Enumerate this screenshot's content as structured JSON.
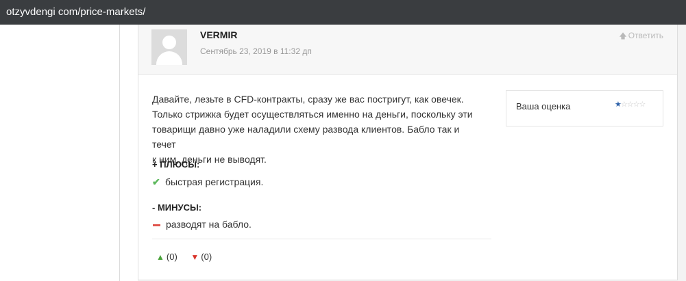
{
  "browser": {
    "url": "otzyvdengi com/price-markets/"
  },
  "comment": {
    "author": "VERMIR",
    "date": "Сентябрь 23, 2019 в 11:32 дп",
    "reply_label": "Ответить",
    "body_lines": [
      "Давайте, лезьте в CFD-контракты, сразу же вас постригут, как овечек.",
      "Только стрижка будет осуществляться именно на деньги, поскольку эти",
      "товарищи давно уже наладили схему развода клиентов. Бабло так и течет",
      "к ним, деньги не выводят."
    ],
    "pros_title": "+ ПЛЮСЫ:",
    "pros": [
      "быстрая регистрация."
    ],
    "cons_title": "- МИНУСЫ:",
    "cons": [
      "разводят на бабло."
    ],
    "likes": "(0)",
    "dislikes": "(0)",
    "rating": {
      "label": "Ваша оценка",
      "value": 1,
      "max": 5
    }
  },
  "colors": {
    "urlbar_bg": "#3a3d40",
    "pros_icon": "#5cb85c",
    "cons_icon": "#e0544c",
    "like_icon": "#4aa33b",
    "dislike_icon": "#d9342b",
    "star_filled": "#2a5fa8"
  },
  "icons": {
    "reply": "arrow-up-icon",
    "pros": "check-icon",
    "cons": "minus-icon",
    "like": "thumbs-up-icon",
    "dislike": "thumbs-down-icon",
    "avatar": "default-avatar-icon"
  }
}
